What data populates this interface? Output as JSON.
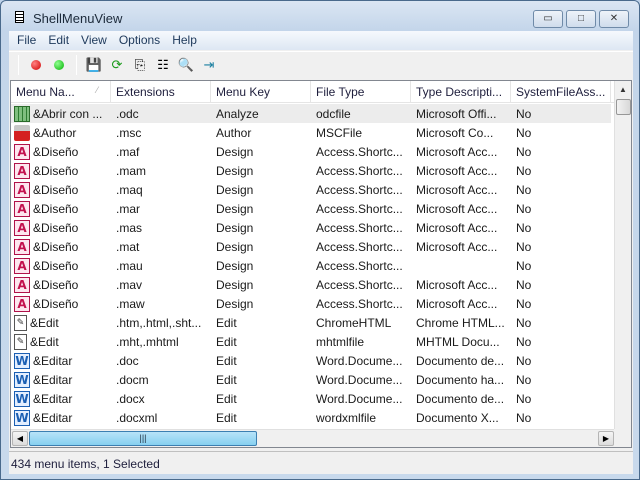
{
  "window": {
    "title": "ShellMenuView",
    "minimize": "▭",
    "maximize": "□",
    "close": "✕"
  },
  "menu": [
    "File",
    "Edit",
    "View",
    "Options",
    "Help"
  ],
  "toolbar": {
    "icons": [
      "red-dot-icon",
      "green-dot-icon",
      "save-icon",
      "refresh-icon",
      "copy-icon",
      "properties-icon",
      "find-icon",
      "exit-icon"
    ]
  },
  "columns": [
    "Menu Na...",
    "Extensions",
    "Menu Key",
    "File Type",
    "Type Descripti...",
    "SystemFileAss..."
  ],
  "rows": [
    {
      "icon": "chart",
      "c": [
        "&Abrir con ...",
        ".odc",
        "Analyze",
        "odcfile",
        "Microsoft Offi...",
        "No"
      ],
      "selected": true
    },
    {
      "icon": "author",
      "c": [
        "&Author",
        ".msc",
        "Author",
        "MSCFile",
        "Microsoft Co...",
        "No"
      ]
    },
    {
      "icon": "access",
      "c": [
        "&Diseño",
        ".maf",
        "Design",
        "Access.Shortc...",
        "Microsoft Acc...",
        "No"
      ]
    },
    {
      "icon": "access",
      "c": [
        "&Diseño",
        ".mam",
        "Design",
        "Access.Shortc...",
        "Microsoft Acc...",
        "No"
      ]
    },
    {
      "icon": "access",
      "c": [
        "&Diseño",
        ".maq",
        "Design",
        "Access.Shortc...",
        "Microsoft Acc...",
        "No"
      ]
    },
    {
      "icon": "access",
      "c": [
        "&Diseño",
        ".mar",
        "Design",
        "Access.Shortc...",
        "Microsoft Acc...",
        "No"
      ]
    },
    {
      "icon": "access",
      "c": [
        "&Diseño",
        ".mas",
        "Design",
        "Access.Shortc...",
        "Microsoft Acc...",
        "No"
      ]
    },
    {
      "icon": "access",
      "c": [
        "&Diseño",
        ".mat",
        "Design",
        "Access.Shortc...",
        "Microsoft Acc...",
        "No"
      ]
    },
    {
      "icon": "access",
      "c": [
        "&Diseño",
        ".mau",
        "Design",
        "Access.Shortc...",
        "",
        "No"
      ]
    },
    {
      "icon": "access",
      "c": [
        "&Diseño",
        ".mav",
        "Design",
        "Access.Shortc...",
        "Microsoft Acc...",
        "No"
      ]
    },
    {
      "icon": "access",
      "c": [
        "&Diseño",
        ".maw",
        "Design",
        "Access.Shortc...",
        "Microsoft Acc...",
        "No"
      ]
    },
    {
      "icon": "edit",
      "c": [
        "&Edit",
        ".htm,.html,.sht...",
        "Edit",
        "ChromeHTML",
        "Chrome HTML...",
        "No"
      ]
    },
    {
      "icon": "edit",
      "c": [
        "&Edit",
        ".mht,.mhtml",
        "Edit",
        "mhtmlfile",
        "MHTML Docu...",
        "No"
      ]
    },
    {
      "icon": "word",
      "c": [
        "&Editar",
        ".doc",
        "Edit",
        "Word.Docume...",
        "Documento de...",
        "No"
      ]
    },
    {
      "icon": "word",
      "c": [
        "&Editar",
        ".docm",
        "Edit",
        "Word.Docume...",
        "Documento ha...",
        "No"
      ]
    },
    {
      "icon": "word",
      "c": [
        "&Editar",
        ".docx",
        "Edit",
        "Word.Docume...",
        "Documento de...",
        "No"
      ]
    },
    {
      "icon": "word",
      "c": [
        "&Editar",
        ".docxml",
        "Edit",
        "wordxmlfile",
        "Documento X...",
        "No"
      ]
    }
  ],
  "status": "434 menu items, 1 Selected"
}
